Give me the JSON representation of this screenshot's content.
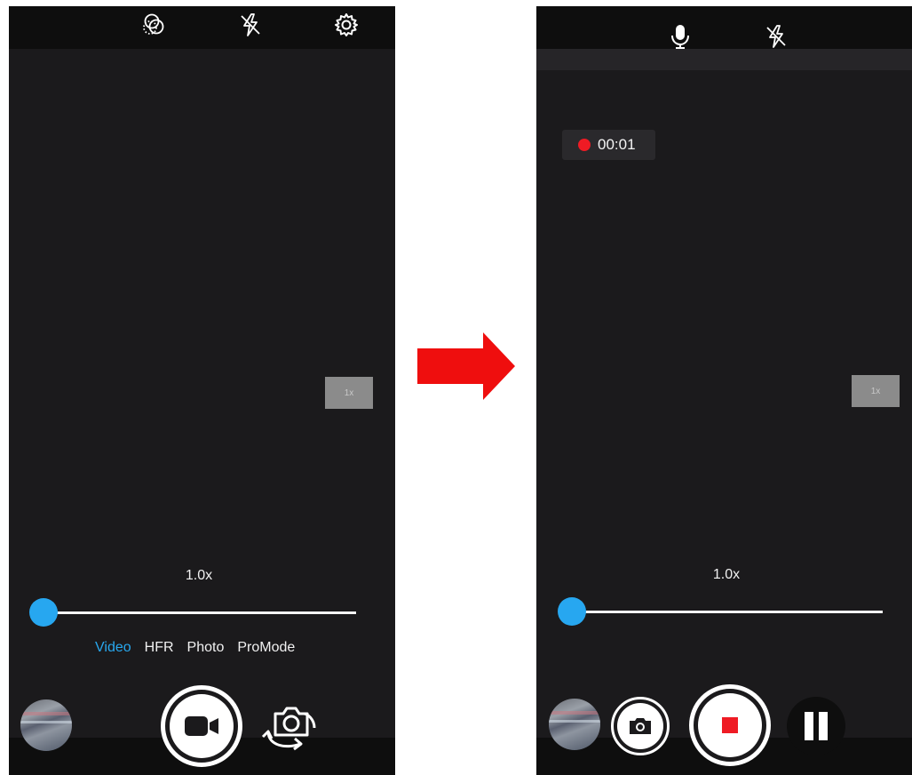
{
  "left_screen": {
    "zoom_badge": "1x",
    "zoom_level": "1.0x",
    "zoom_slider_value": 0,
    "modes": [
      {
        "label": "Video",
        "active": true
      },
      {
        "label": "HFR",
        "active": false
      },
      {
        "label": "Photo",
        "active": false
      },
      {
        "label": "ProMode",
        "active": false
      }
    ],
    "icons": {
      "filter": "filter-icon",
      "flash": "flash-off-icon",
      "settings": "gear-icon",
      "record": "video-camera-icon",
      "switch_camera": "switch-camera-icon"
    }
  },
  "right_screen": {
    "recording_time": "00:01",
    "zoom_badge": "1x",
    "zoom_level": "1.0x",
    "zoom_slider_value": 0,
    "icons": {
      "microphone": "microphone-icon",
      "flash": "flash-off-icon",
      "snapshot": "camera-icon",
      "stop": "stop-icon",
      "pause": "pause-icon"
    }
  },
  "colors": {
    "accent": "#27a7f0",
    "record_red": "#ef1b24",
    "transition_arrow": "#ef0e0e"
  }
}
